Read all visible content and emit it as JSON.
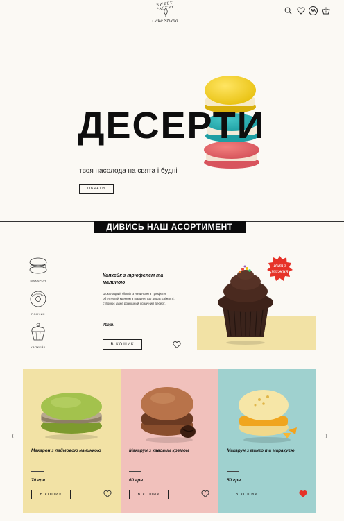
{
  "header": {
    "brand_top": "SWEET PASTRY",
    "brand_script": "Cake Studio",
    "lang": "AA"
  },
  "hero": {
    "title": "ДЕСЕРТИ",
    "subtitle": "твоя насолода на свята і будні",
    "button": "ОБРАТИ"
  },
  "assortment": {
    "banner": "ДИВИСЬ НАШ АСОРТИМЕНТ",
    "categories": [
      {
        "label": "МАКАРОН",
        "icon": "macaron-icon"
      },
      {
        "label": "ПОНЧИК",
        "icon": "donut-icon"
      },
      {
        "label": "КАПКЕЙК",
        "icon": "cupcake-icon"
      }
    ],
    "featured": {
      "title": "Капкейк з трюфелем та малиною",
      "description": "Шоколадний бісквіт з начинкою з трюфеля, обтягнутий кремом з малини, що додає свіжості, створює дуже розкішний і смачний десерт.",
      "price": "70грн",
      "cart": "В КОШИК",
      "badge": "Вибір тижня"
    }
  },
  "products": [
    {
      "title": "Макарон з лаймовою начинкою",
      "price": "70 грн",
      "cart": "В КОШИК",
      "bg": "#f2e2a5",
      "liked": false
    },
    {
      "title": "Макарун з кавовим кремом",
      "price": "60 грн",
      "cart": "В КОШИК",
      "bg": "#f1c1bc",
      "liked": false
    },
    {
      "title": "Макарун з манго та маракуєю",
      "price": "50 грн",
      "cart": "В КОШИК",
      "bg": "#9fd1cf",
      "liked": true
    }
  ],
  "colors": {
    "accent_red": "#e63228",
    "yellow": "#f2e2a5",
    "pink": "#f1c1bc",
    "teal": "#9fd1cf"
  }
}
